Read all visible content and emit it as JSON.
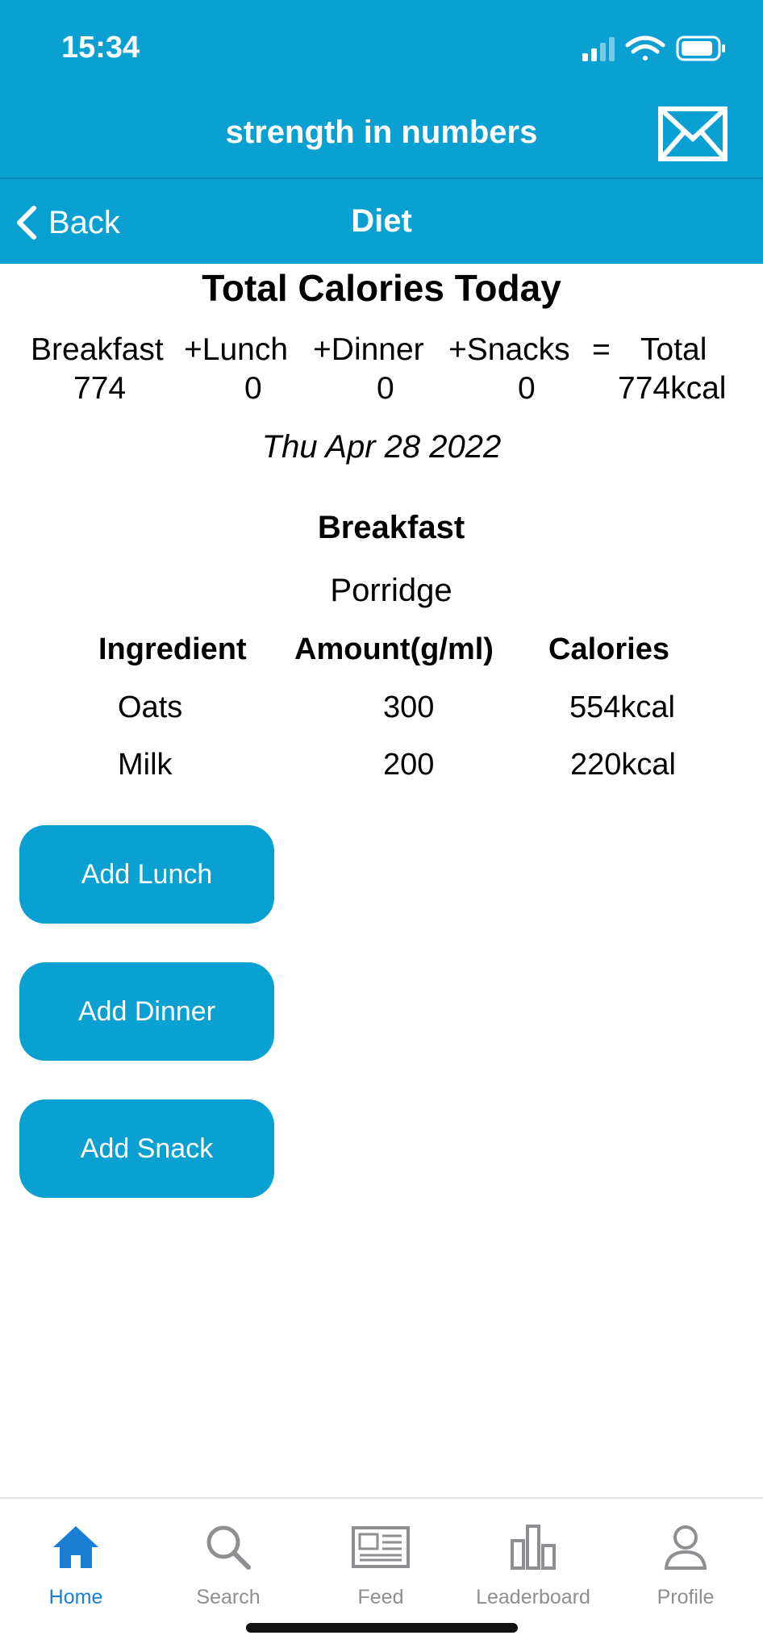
{
  "status_bar": {
    "time": "15:34"
  },
  "header": {
    "app_title": "strength in numbers",
    "mail_icon": "envelope-icon"
  },
  "nav": {
    "back_label": "Back",
    "title": "Diet"
  },
  "totals": {
    "title": "Total Calories Today",
    "labels": {
      "breakfast": "Breakfast",
      "lunch": "+Lunch",
      "dinner": "+Dinner",
      "snacks": "+Snacks",
      "equals": "=",
      "total": "Total"
    },
    "values": {
      "breakfast": "774",
      "lunch": "0",
      "dinner": "0",
      "snacks": "0",
      "total": "774kcal"
    },
    "date": "Thu Apr 28 2022"
  },
  "meal": {
    "heading": "Breakfast",
    "dish": "Porridge",
    "columns": [
      "Ingredient",
      "Amount(g/ml)",
      "Calories"
    ],
    "rows": [
      {
        "ingredient": "Oats",
        "amount": "300",
        "calories": "554kcal"
      },
      {
        "ingredient": "Milk",
        "amount": "200",
        "calories": "220kcal"
      }
    ]
  },
  "actions": {
    "add_lunch": "Add Lunch",
    "add_dinner": "Add Dinner",
    "add_snack": "Add Snack"
  },
  "tabs": [
    {
      "label": "Home",
      "icon": "home-icon",
      "active": true
    },
    {
      "label": "Search",
      "icon": "search-icon",
      "active": false
    },
    {
      "label": "Feed",
      "icon": "newspaper-icon",
      "active": false
    },
    {
      "label": "Leaderboard",
      "icon": "bar-chart-icon",
      "active": false
    },
    {
      "label": "Profile",
      "icon": "person-icon",
      "active": false
    }
  ],
  "colors": {
    "brand": "#0aa0d1",
    "active_tab": "#1a7ed3",
    "inactive_tab": "#8e8e93"
  }
}
